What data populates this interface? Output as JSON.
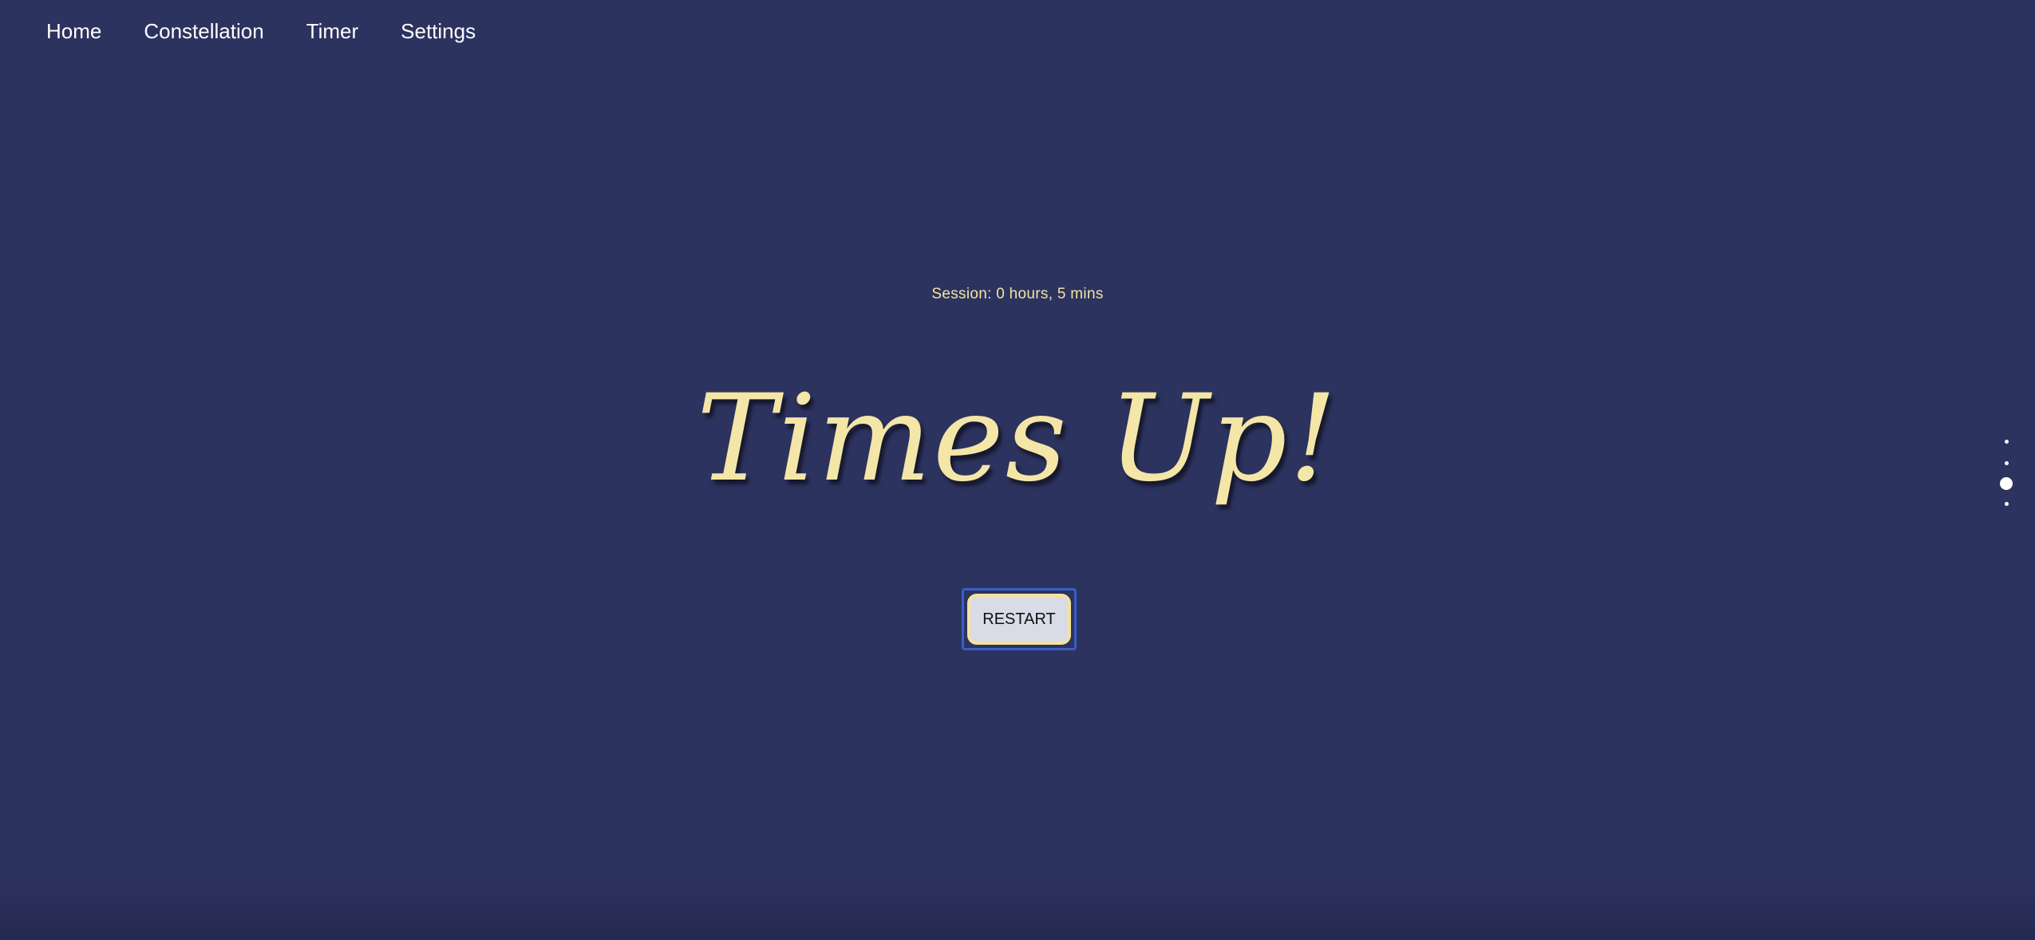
{
  "nav": {
    "items": [
      {
        "label": "Home"
      },
      {
        "label": "Constellation"
      },
      {
        "label": "Timer"
      },
      {
        "label": "Settings"
      }
    ]
  },
  "main": {
    "session_text": "Session: 0 hours, 5 mins",
    "title": "Times Up!",
    "restart_label": "RESTART"
  },
  "page_indicator": {
    "total": 4,
    "active_index": 2
  },
  "colors": {
    "background": "#2d335f",
    "accent_yellow": "#f4e6a7",
    "focus_ring": "#3a5fc4"
  }
}
